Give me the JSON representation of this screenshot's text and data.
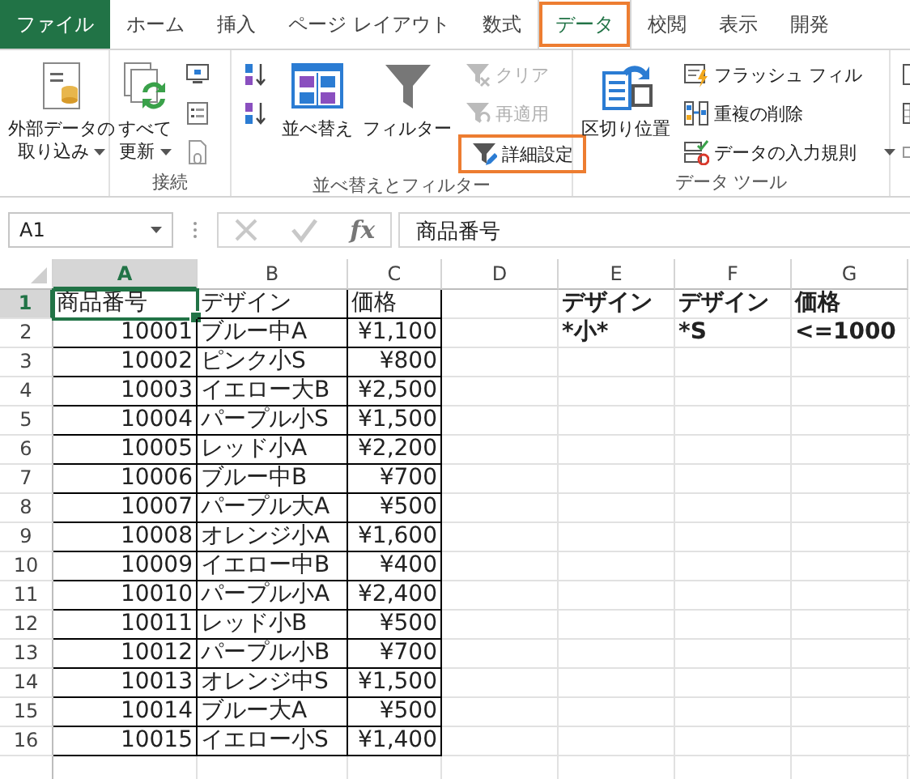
{
  "tabs": [
    {
      "label": "ファイル",
      "kind": "file",
      "selected": false
    },
    {
      "label": "ホーム",
      "kind": "tab",
      "selected": false
    },
    {
      "label": "挿入",
      "kind": "tab",
      "selected": false
    },
    {
      "label": "ページ レイアウト",
      "kind": "tab",
      "selected": false
    },
    {
      "label": "数式",
      "kind": "tab",
      "selected": false
    },
    {
      "label": "データ",
      "kind": "tab",
      "selected": true
    },
    {
      "label": "校閲",
      "kind": "tab",
      "selected": false
    },
    {
      "label": "表示",
      "kind": "tab",
      "selected": false
    },
    {
      "label": "開発",
      "kind": "tab",
      "selected": false
    }
  ],
  "ribbon": {
    "groups": [
      {
        "items": [
          {
            "kind": "large",
            "label_lines": [
              "外部データの",
              "取り込み"
            ],
            "dropdown": true,
            "disabled": false,
            "highlighted": false
          }
        ]
      },
      {
        "label": "接続",
        "items": [
          {
            "kind": "large",
            "label_lines": [
              "すべて",
              "更新"
            ],
            "dropdown": true,
            "disabled": false,
            "highlighted": false
          },
          {
            "kind": "icon"
          },
          {
            "kind": "icon"
          },
          {
            "kind": "icon"
          }
        ]
      },
      {
        "label": "並べ替えとフィルター",
        "items": [
          {
            "kind": "icon"
          },
          {
            "kind": "icon"
          },
          {
            "kind": "large",
            "label_lines": [
              "並べ替え"
            ],
            "disabled": false,
            "highlighted": false
          },
          {
            "kind": "large",
            "label_lines": [
              "フィルター"
            ],
            "disabled": false,
            "highlighted": false
          },
          {
            "kind": "small",
            "label": "クリア",
            "disabled": true,
            "highlighted": false
          },
          {
            "kind": "small",
            "label": "再適用",
            "disabled": true,
            "highlighted": false
          },
          {
            "kind": "small",
            "label": "詳細設定",
            "disabled": false,
            "highlighted": true
          }
        ]
      },
      {
        "label": "データ ツール",
        "items": [
          {
            "kind": "large",
            "label_lines": [
              "区切り位置"
            ],
            "disabled": false,
            "highlighted": false
          },
          {
            "kind": "small",
            "label": "フラッシュ フィル",
            "disabled": false,
            "highlighted": false
          },
          {
            "kind": "small",
            "label": "重複の削除",
            "disabled": false,
            "highlighted": false
          },
          {
            "kind": "small",
            "label": "データの入力規則",
            "dropdown": true,
            "disabled": false,
            "highlighted": false
          }
        ]
      },
      {
        "items": [
          {
            "kind": "icon"
          },
          {
            "kind": "icon"
          },
          {
            "kind": "icon"
          }
        ]
      }
    ]
  },
  "formula_bar": {
    "name_box": "A1",
    "function_label": "fx",
    "content": "商品番号"
  },
  "columns": [
    {
      "label": "A",
      "selected": true
    },
    {
      "label": "B",
      "selected": false
    },
    {
      "label": "C",
      "selected": false
    },
    {
      "label": "D",
      "selected": false
    },
    {
      "label": "E",
      "selected": false
    },
    {
      "label": "F",
      "selected": false
    },
    {
      "label": "G",
      "selected": false
    }
  ],
  "rows": [
    {
      "header": "1",
      "kind": "header",
      "selected": true,
      "table": [
        "商品番号",
        "デザイン",
        "価格"
      ],
      "criteria": [
        "デザイン",
        "デザイン",
        "価格"
      ]
    },
    {
      "header": "2",
      "kind": "record",
      "selected": false,
      "table": [
        "10001",
        "ブルー中A",
        "¥1,100"
      ],
      "criteria": [
        "*小*",
        "*S",
        "<=1000"
      ]
    },
    {
      "header": "3",
      "kind": "record",
      "selected": false,
      "table": [
        "10002",
        "ピンク小S",
        "¥800"
      ]
    },
    {
      "header": "4",
      "kind": "record",
      "selected": false,
      "table": [
        "10003",
        "イエロー大B",
        "¥2,500"
      ]
    },
    {
      "header": "5",
      "kind": "record",
      "selected": false,
      "table": [
        "10004",
        "パープル小S",
        "¥1,500"
      ]
    },
    {
      "header": "6",
      "kind": "record",
      "selected": false,
      "table": [
        "10005",
        "レッド小A",
        "¥2,200"
      ]
    },
    {
      "header": "7",
      "kind": "record",
      "selected": false,
      "table": [
        "10006",
        "ブルー中B",
        "¥700"
      ]
    },
    {
      "header": "8",
      "kind": "record",
      "selected": false,
      "table": [
        "10007",
        "パープル大A",
        "¥500"
      ]
    },
    {
      "header": "9",
      "kind": "record",
      "selected": false,
      "table": [
        "10008",
        "オレンジ小A",
        "¥1,600"
      ]
    },
    {
      "header": "10",
      "kind": "record",
      "selected": false,
      "table": [
        "10009",
        "イエロー中B",
        "¥400"
      ]
    },
    {
      "header": "11",
      "kind": "record",
      "selected": false,
      "table": [
        "10010",
        "パープル小A",
        "¥2,400"
      ]
    },
    {
      "header": "12",
      "kind": "record",
      "selected": false,
      "table": [
        "10011",
        "レッド小B",
        "¥500"
      ]
    },
    {
      "header": "13",
      "kind": "record",
      "selected": false,
      "table": [
        "10012",
        "パープル小B",
        "¥700"
      ]
    },
    {
      "header": "14",
      "kind": "record",
      "selected": false,
      "table": [
        "10013",
        "オレンジ中S",
        "¥1,500"
      ]
    },
    {
      "header": "15",
      "kind": "record",
      "selected": false,
      "table": [
        "10014",
        "ブルー大A",
        "¥500"
      ]
    },
    {
      "header": "16",
      "kind": "record",
      "selected": false,
      "table": [
        "10015",
        "イエロー小S",
        "¥1,400"
      ]
    }
  ]
}
